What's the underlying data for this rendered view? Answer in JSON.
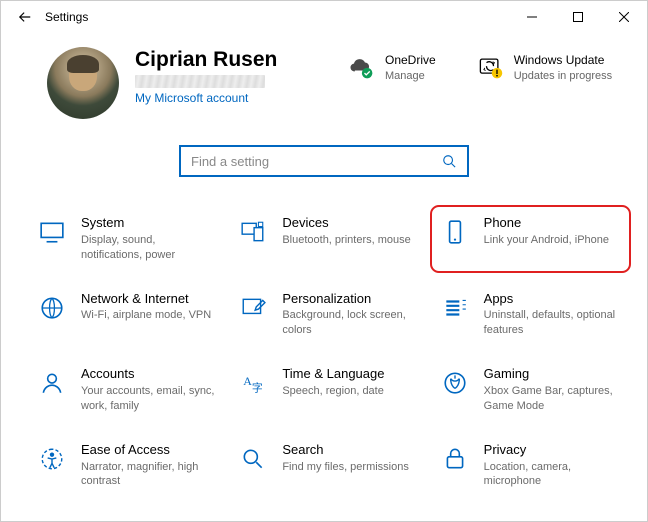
{
  "window": {
    "title": "Settings"
  },
  "user": {
    "name": "Ciprian Rusen",
    "account_link": "My Microsoft account"
  },
  "onedrive": {
    "title": "OneDrive",
    "sub": "Manage"
  },
  "update": {
    "title": "Windows Update",
    "sub": "Updates in progress"
  },
  "search": {
    "placeholder": "Find a setting"
  },
  "tiles": [
    {
      "title": "System",
      "sub": "Display, sound, notifications, power"
    },
    {
      "title": "Devices",
      "sub": "Bluetooth, printers, mouse"
    },
    {
      "title": "Phone",
      "sub": "Link your Android, iPhone"
    },
    {
      "title": "Network & Internet",
      "sub": "Wi-Fi, airplane mode, VPN"
    },
    {
      "title": "Personalization",
      "sub": "Background, lock screen, colors"
    },
    {
      "title": "Apps",
      "sub": "Uninstall, defaults, optional features"
    },
    {
      "title": "Accounts",
      "sub": "Your accounts, email, sync, work, family"
    },
    {
      "title": "Time & Language",
      "sub": "Speech, region, date"
    },
    {
      "title": "Gaming",
      "sub": "Xbox Game Bar, captures, Game Mode"
    },
    {
      "title": "Ease of Access",
      "sub": "Narrator, magnifier, high contrast"
    },
    {
      "title": "Search",
      "sub": "Find my files, permissions"
    },
    {
      "title": "Privacy",
      "sub": "Location, camera, microphone"
    }
  ]
}
